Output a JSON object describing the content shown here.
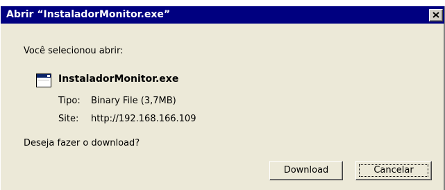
{
  "dialog": {
    "title": "Abrir “InstaladorMonitor.exe”",
    "prompt": "Você selecionou abrir:",
    "file": {
      "icon": "application-window-icon",
      "name": "InstaladorMonitor.exe"
    },
    "details": [
      {
        "label": "Tipo:",
        "value": "Binary File (3,7MB)"
      },
      {
        "label": "Site:",
        "value": "http://192.168.166.109"
      }
    ],
    "question": "Deseja fazer o download?",
    "buttons": {
      "download": "Download",
      "cancel": "Cancelar"
    }
  },
  "colors": {
    "titlebar": "#000080",
    "dialog_background": "#ece9d8"
  }
}
